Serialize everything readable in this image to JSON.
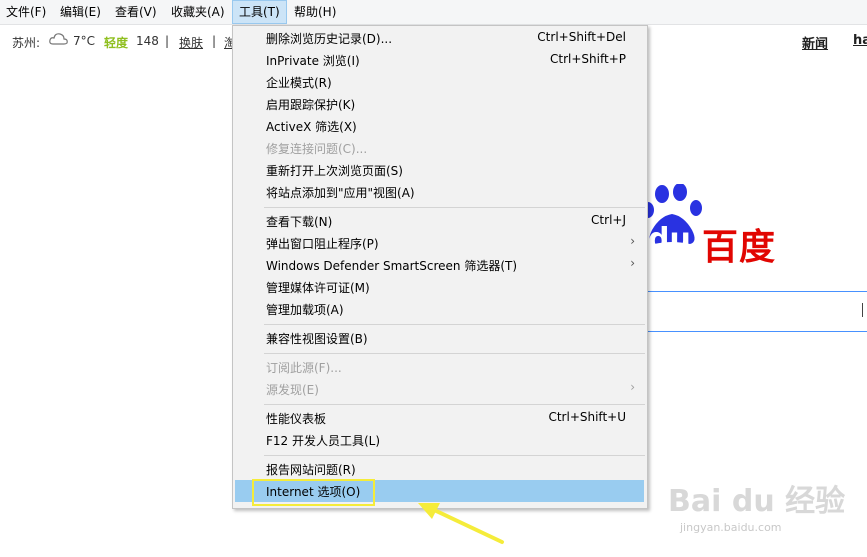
{
  "menubar": {
    "items": [
      {
        "label": "文件(F)"
      },
      {
        "label": "编辑(E)"
      },
      {
        "label": "查看(V)"
      },
      {
        "label": "收藏夹(A)"
      },
      {
        "label": "工具(T)"
      },
      {
        "label": "帮助(H)"
      }
    ]
  },
  "toolbar": {
    "city": "苏州:",
    "temp": "7°C",
    "aq_label": "轻度",
    "aq_value": "148",
    "change_skin": "换肤",
    "partial_link": "淘",
    "nav_news": "新闻",
    "nav_partial": "ha"
  },
  "tools_menu": {
    "groups": [
      [
        {
          "label": "删除浏览历史记录(D)...",
          "shortcut": "Ctrl+Shift+Del"
        },
        {
          "label": "InPrivate 浏览(I)",
          "shortcut": "Ctrl+Shift+P"
        },
        {
          "label": "企业模式(R)"
        },
        {
          "label": "启用跟踪保护(K)"
        },
        {
          "label": "ActiveX 筛选(X)"
        },
        {
          "label": "修复连接问题(C)...",
          "disabled": true
        },
        {
          "label": "重新打开上次浏览页面(S)"
        },
        {
          "label": "将站点添加到\"应用\"视图(A)"
        }
      ],
      [
        {
          "label": "查看下载(N)",
          "shortcut": "Ctrl+J"
        },
        {
          "label": "弹出窗口阻止程序(P)",
          "submenu": true
        },
        {
          "label": "Windows Defender SmartScreen 筛选器(T)",
          "submenu": true
        },
        {
          "label": "管理媒体许可证(M)"
        },
        {
          "label": "管理加载项(A)"
        }
      ],
      [
        {
          "label": "兼容性视图设置(B)"
        }
      ],
      [
        {
          "label": "订阅此源(F)...",
          "disabled": true
        },
        {
          "label": "源发现(E)",
          "disabled": true,
          "submenu": true
        }
      ],
      [
        {
          "label": "性能仪表板",
          "shortcut": "Ctrl+Shift+U"
        },
        {
          "label": "F12 开发人员工具(L)"
        }
      ],
      [
        {
          "label": "报告网站问题(R)"
        },
        {
          "label": "Internet 选项(O)",
          "highlighted": true
        }
      ]
    ],
    "submenu_glyph": "›"
  },
  "baidu": {
    "logo_du": "du",
    "logo_cn": "百度"
  },
  "watermark": {
    "main": "Bai du 经验",
    "url": "jingyan.baidu.com"
  },
  "colors": {
    "highlight": "#99ccf0",
    "annotation_yellow": "#f5ec3a",
    "baidu_blue": "#2932e1",
    "baidu_red": "#e10602"
  }
}
